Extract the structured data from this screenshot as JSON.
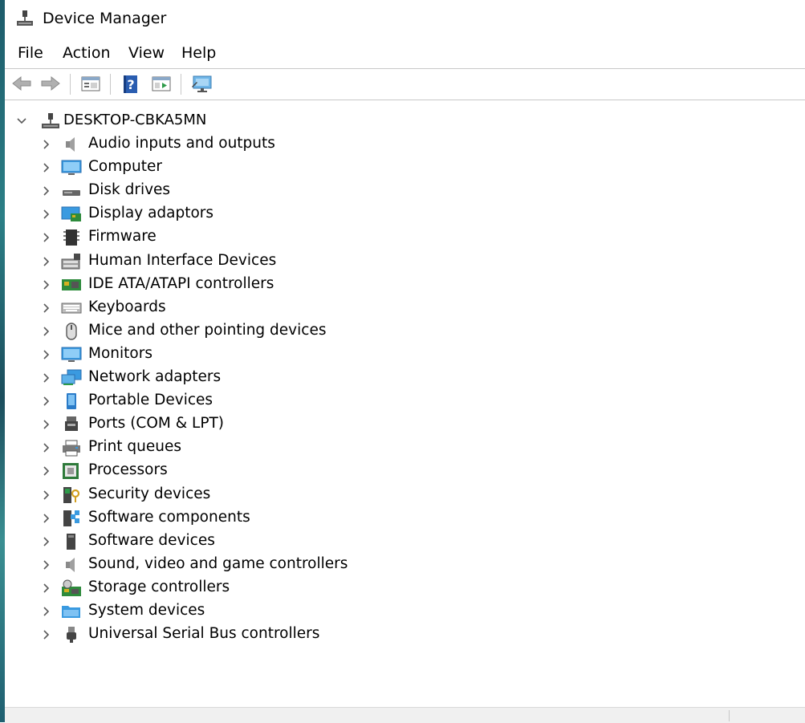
{
  "window": {
    "title": "Device Manager",
    "icon": "computer-network-icon"
  },
  "menu": [
    "File",
    "Action",
    "View",
    "Help"
  ],
  "toolbar": {
    "buttons": [
      "back-arrow-icon",
      "forward-arrow-icon",
      "properties-icon",
      "help-icon",
      "update-driver-icon",
      "monitor-scan-icon"
    ]
  },
  "tree": {
    "root": {
      "label": "DESKTOP-CBKA5MN",
      "expanded": true,
      "icon": "computer-network-icon"
    },
    "categories": [
      {
        "label": "Audio inputs and outputs",
        "icon": "speaker-icon"
      },
      {
        "label": "Computer",
        "icon": "monitor-icon"
      },
      {
        "label": "Disk drives",
        "icon": "disk-drive-icon"
      },
      {
        "label": "Display adaptors",
        "icon": "display-adapter-icon"
      },
      {
        "label": "Firmware",
        "icon": "chip-icon"
      },
      {
        "label": "Human Interface Devices",
        "icon": "hid-icon"
      },
      {
        "label": "IDE ATA/ATAPI controllers",
        "icon": "ide-controller-icon"
      },
      {
        "label": "Keyboards",
        "icon": "keyboard-icon"
      },
      {
        "label": "Mice and other pointing devices",
        "icon": "mouse-icon"
      },
      {
        "label": "Monitors",
        "icon": "monitor-icon"
      },
      {
        "label": "Network adapters",
        "icon": "network-adapter-icon"
      },
      {
        "label": "Portable Devices",
        "icon": "portable-device-icon"
      },
      {
        "label": "Ports (COM & LPT)",
        "icon": "port-icon"
      },
      {
        "label": "Print queues",
        "icon": "printer-icon"
      },
      {
        "label": "Processors",
        "icon": "processor-icon"
      },
      {
        "label": "Security devices",
        "icon": "security-key-icon"
      },
      {
        "label": "Software components",
        "icon": "software-component-icon"
      },
      {
        "label": "Software devices",
        "icon": "software-device-icon"
      },
      {
        "label": "Sound, video and game controllers",
        "icon": "speaker-icon"
      },
      {
        "label": "Storage controllers",
        "icon": "storage-controller-icon"
      },
      {
        "label": "System devices",
        "icon": "folder-icon"
      },
      {
        "label": "Universal Serial Bus controllers",
        "icon": "usb-icon"
      }
    ]
  },
  "colors": {
    "accent_blue": "#2e8bd8",
    "separator": "#c8c8c8",
    "chevron": "#5a5a5a"
  }
}
